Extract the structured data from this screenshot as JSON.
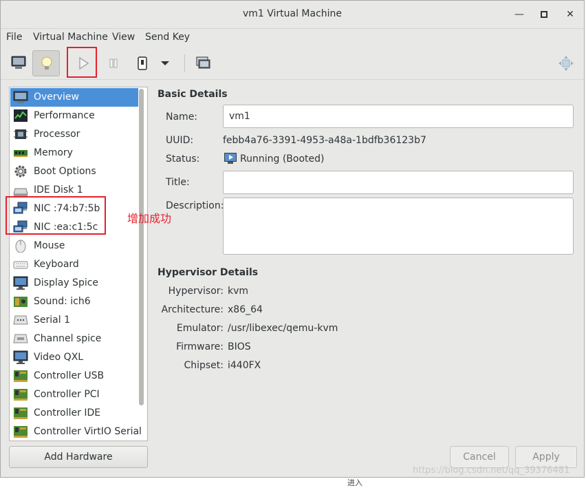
{
  "window": {
    "title": "vm1 Virtual Machine"
  },
  "menubar": {
    "items": [
      "File",
      "Virtual Machine",
      "View",
      "Send Key"
    ]
  },
  "sidebar": {
    "items": [
      {
        "label": "Overview",
        "icon": "overview-icon"
      },
      {
        "label": "Performance",
        "icon": "performance-icon"
      },
      {
        "label": "Processor",
        "icon": "processor-icon"
      },
      {
        "label": "Memory",
        "icon": "memory-icon"
      },
      {
        "label": "Boot Options",
        "icon": "gear-icon"
      },
      {
        "label": "IDE Disk 1",
        "icon": "disk-icon"
      },
      {
        "label": "NIC :74:b7:5b",
        "icon": "network-icon"
      },
      {
        "label": "NIC :ea:c1:5c",
        "icon": "network-icon"
      },
      {
        "label": "Mouse",
        "icon": "mouse-icon"
      },
      {
        "label": "Keyboard",
        "icon": "keyboard-icon"
      },
      {
        "label": "Display Spice",
        "icon": "monitor-icon"
      },
      {
        "label": "Sound: ich6",
        "icon": "sound-icon"
      },
      {
        "label": "Serial 1",
        "icon": "serial-icon"
      },
      {
        "label": "Channel spice",
        "icon": "channel-icon"
      },
      {
        "label": "Video QXL",
        "icon": "monitor-icon"
      },
      {
        "label": "Controller USB",
        "icon": "controller-icon"
      },
      {
        "label": "Controller PCI",
        "icon": "controller-icon"
      },
      {
        "label": "Controller IDE",
        "icon": "controller-icon"
      },
      {
        "label": "Controller VirtIO Serial",
        "icon": "controller-icon"
      }
    ],
    "selected_index": 0,
    "add_hardware_label": "Add Hardware"
  },
  "basic": {
    "section_title": "Basic Details",
    "name_label": "Name:",
    "name_value": "vm1",
    "uuid_label": "UUID:",
    "uuid_value": "febb4a76-3391-4953-a48a-1bdfb36123b7",
    "status_label": "Status:",
    "status_value": "Running (Booted)",
    "title_label": "Title:",
    "title_value": "",
    "description_label": "Description:",
    "description_value": ""
  },
  "hypervisor": {
    "section_title": "Hypervisor Details",
    "hypervisor_label": "Hypervisor:",
    "hypervisor_value": "kvm",
    "architecture_label": "Architecture:",
    "architecture_value": "x86_64",
    "emulator_label": "Emulator:",
    "emulator_value": "/usr/libexec/qemu-kvm",
    "firmware_label": "Firmware:",
    "firmware_value": "BIOS",
    "chipset_label": "Chipset:",
    "chipset_value": "i440FX"
  },
  "footer": {
    "cancel_label": "Cancel",
    "apply_label": "Apply"
  },
  "annotation": {
    "text": "增加成功",
    "color": "#e4212b"
  },
  "watermark": {
    "text": "https://blog.csdn.net/qq_39376481"
  },
  "bottom_fragment": {
    "text": "进入"
  },
  "colors": {
    "selection": "#4a90d9",
    "highlight_box": "#e4212b"
  }
}
